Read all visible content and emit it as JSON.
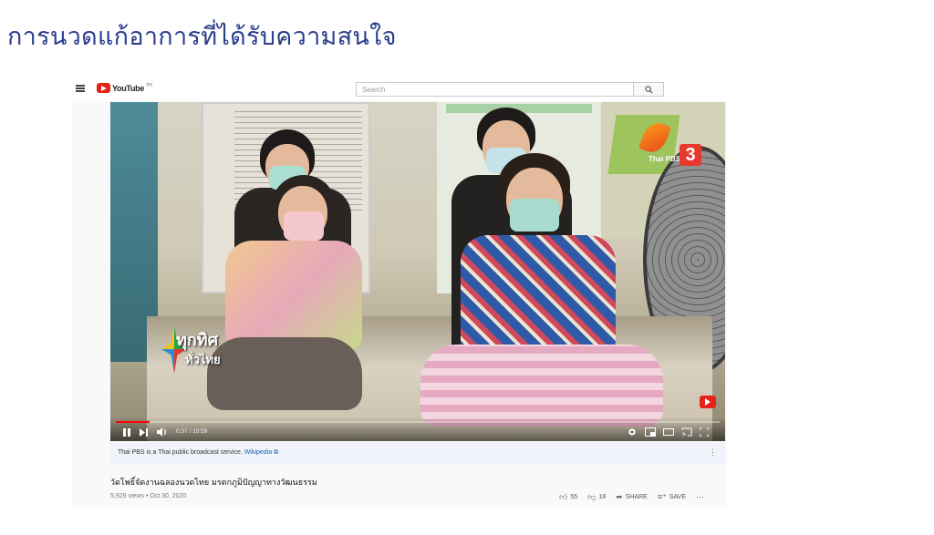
{
  "slide": {
    "title": "การนวดแก้อาการที่ได้รับความสนใจ"
  },
  "youtube": {
    "logo_text": "YouTube",
    "logo_sup": "TH",
    "search_placeholder": "Search",
    "search_icon": "search-icon"
  },
  "player": {
    "channel_logo": "Thai PBS",
    "channel_number": "3",
    "program_line1": "ทุกทิศ",
    "program_line2": "ทั่วไทย",
    "time": "0:37 / 10:59",
    "progress_fraction": 0.056
  },
  "info_bar": {
    "text": "Thai PBS is a Thai public broadcast service.",
    "link": "Wikipedia"
  },
  "video": {
    "title": "วัดโพธิ์จัดงานฉลองนวดไทย มรดกภูมิปัญญาทางวัฒนธรรม",
    "meta": "5,929 views • Oct 30, 2020",
    "likes": "55",
    "dislikes": "18",
    "share_label": "SHARE",
    "save_label": "SAVE"
  }
}
